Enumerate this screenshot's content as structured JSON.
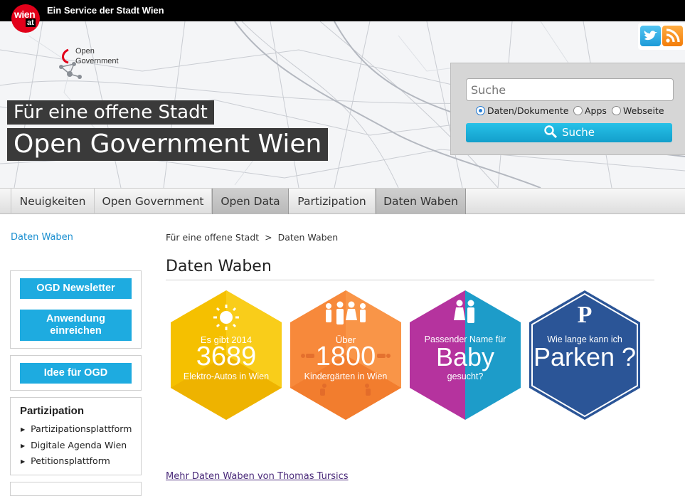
{
  "header": {
    "logo_line1": "wien",
    "logo_line2": "at",
    "service_text": "Ein Service der Stadt Wien",
    "og_logo_line1": "Open",
    "og_logo_line2": "Government"
  },
  "hero": {
    "claim_small": "Für eine offene Stadt",
    "claim_large": "Open Government Wien"
  },
  "search": {
    "placeholder": "Suche",
    "options": [
      "Daten/Dokumente",
      "Apps",
      "Webseite"
    ],
    "selected": "Daten/Dokumente",
    "button_label": "Suche"
  },
  "nav": {
    "items": [
      "Neuigkeiten",
      "Open Government",
      "Open Data",
      "Partizipation",
      "Daten Waben"
    ]
  },
  "sidebar": {
    "current_link": "Daten Waben",
    "buttons": [
      "OGD Newsletter",
      "Anwendung einreichen",
      "Idee für OGD"
    ],
    "participation": {
      "title": "Partizipation",
      "items": [
        "Partizipationsplattform",
        "Digitale Agenda Wien",
        "Petitionsplattform"
      ]
    }
  },
  "main": {
    "breadcrumb_parent": "Für eine offene Stadt",
    "breadcrumb_sep": ">",
    "breadcrumb_current": "Daten Waben",
    "title": "Daten Waben",
    "hexes": [
      {
        "top": "Es gibt 2014",
        "big": "3689",
        "bottom": "Elektro-Autos in Wien",
        "color": "#f5c000"
      },
      {
        "top": "Über",
        "big": "1800",
        "bottom": "Kindergärten in Wien",
        "color": "#f7893b"
      },
      {
        "top": "Passender Name für",
        "big": "Baby",
        "bottom": "gesucht?",
        "color_left": "#b5339e",
        "color_right": "#1d9cc9"
      },
      {
        "letter": "P",
        "top": "Wie lange kann ich",
        "big": "Parken ?",
        "color": "#2b5597"
      }
    ],
    "more_link": "Mehr Daten Waben von Thomas Tursics"
  }
}
